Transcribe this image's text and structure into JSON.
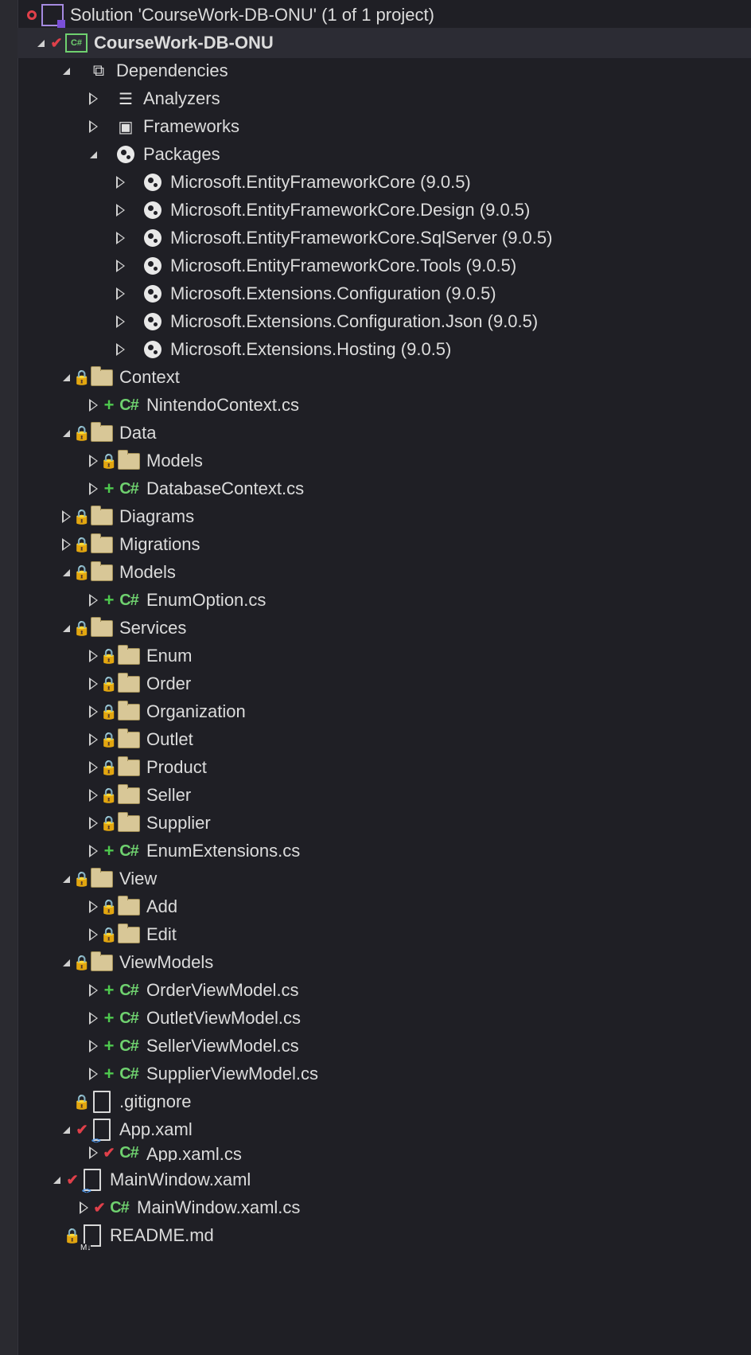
{
  "solution": {
    "label": "Solution 'CourseWork-DB-ONU' (1 of 1 project)"
  },
  "project": {
    "label": "CourseWork-DB-ONU",
    "icon_text": "C#"
  },
  "dependencies": {
    "label": "Dependencies",
    "analyzers": "Analyzers",
    "frameworks": "Frameworks",
    "packages": {
      "label": "Packages",
      "items": [
        "Microsoft.EntityFrameworkCore (9.0.5)",
        "Microsoft.EntityFrameworkCore.Design (9.0.5)",
        "Microsoft.EntityFrameworkCore.SqlServer (9.0.5)",
        "Microsoft.EntityFrameworkCore.Tools (9.0.5)",
        "Microsoft.Extensions.Configuration (9.0.5)",
        "Microsoft.Extensions.Configuration.Json (9.0.5)",
        "Microsoft.Extensions.Hosting (9.0.5)"
      ]
    }
  },
  "folders": {
    "context": {
      "label": "Context",
      "files": [
        "NintendoContext.cs"
      ]
    },
    "data": {
      "label": "Data",
      "subfolders": [
        "Models"
      ],
      "files": [
        "DatabaseContext.cs"
      ]
    },
    "diagrams": {
      "label": "Diagrams"
    },
    "migrations": {
      "label": "Migrations"
    },
    "models": {
      "label": "Models",
      "files": [
        "EnumOption.cs"
      ]
    },
    "services": {
      "label": "Services",
      "subfolders": [
        "Enum",
        "Order",
        "Organization",
        "Outlet",
        "Product",
        "Seller",
        "Supplier"
      ],
      "files": [
        "EnumExtensions.cs"
      ]
    },
    "view": {
      "label": "View",
      "subfolders": [
        "Add",
        "Edit"
      ]
    },
    "viewmodels": {
      "label": "ViewModels",
      "files": [
        "OrderViewModel.cs",
        "OutletViewModel.cs",
        "SellerViewModel.cs",
        "SupplierViewModel.cs"
      ]
    }
  },
  "root_files": {
    "gitignore": ".gitignore",
    "app_xaml": "App.xaml",
    "app_xaml_cs": "App.xaml.cs",
    "mainwindow_xaml": "MainWindow.xaml",
    "mainwindow_xaml_cs": "MainWindow.xaml.cs",
    "readme": "README.md"
  },
  "icons": {
    "cs_text": "C#",
    "lock": "🔒",
    "add": "+",
    "check": "✔"
  },
  "colors": {
    "background": "#1f1f25",
    "lock": "#4ea1ff",
    "add": "#4ec94e",
    "check": "#e0404a",
    "folder": "#d8c797"
  }
}
